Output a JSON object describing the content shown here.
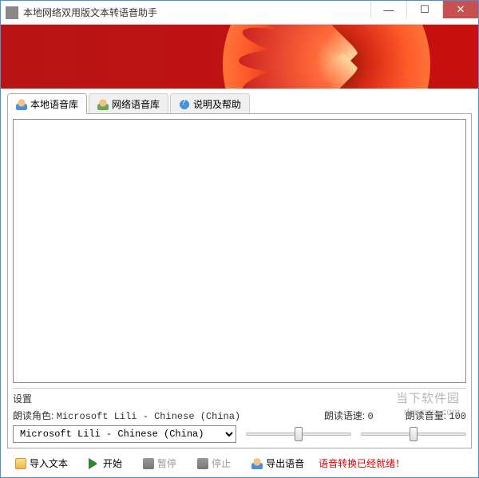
{
  "window": {
    "title": "本地网络双用版文本转语音助手"
  },
  "tabs": [
    {
      "label": "本地语音库",
      "active": true
    },
    {
      "label": "网络语音库",
      "active": false
    },
    {
      "label": "说明及帮助",
      "active": false
    }
  ],
  "textInput": {
    "value": ""
  },
  "settings": {
    "title": "设置",
    "voiceLabel": "朗读角色:",
    "voiceValue": "Microsoft Lili - Chinese (China)",
    "voiceSelectValue": "Microsoft Lili - Chinese (China)",
    "speedLabel": "朗读语速:",
    "speedValue": "0",
    "volumeLabel": "朗读音量:",
    "volumeValue": "100",
    "speedSliderPercent": 50,
    "volumeSliderPercent": 50
  },
  "bottomBar": {
    "importText": "导入文本",
    "start": "开始",
    "pause": "暂停",
    "stop": "停止",
    "exportAudio": "导出语音",
    "status": "语音转换已经就绪！"
  },
  "watermark": {
    "line1": "当下软件园",
    "line2": "downxia.com"
  }
}
